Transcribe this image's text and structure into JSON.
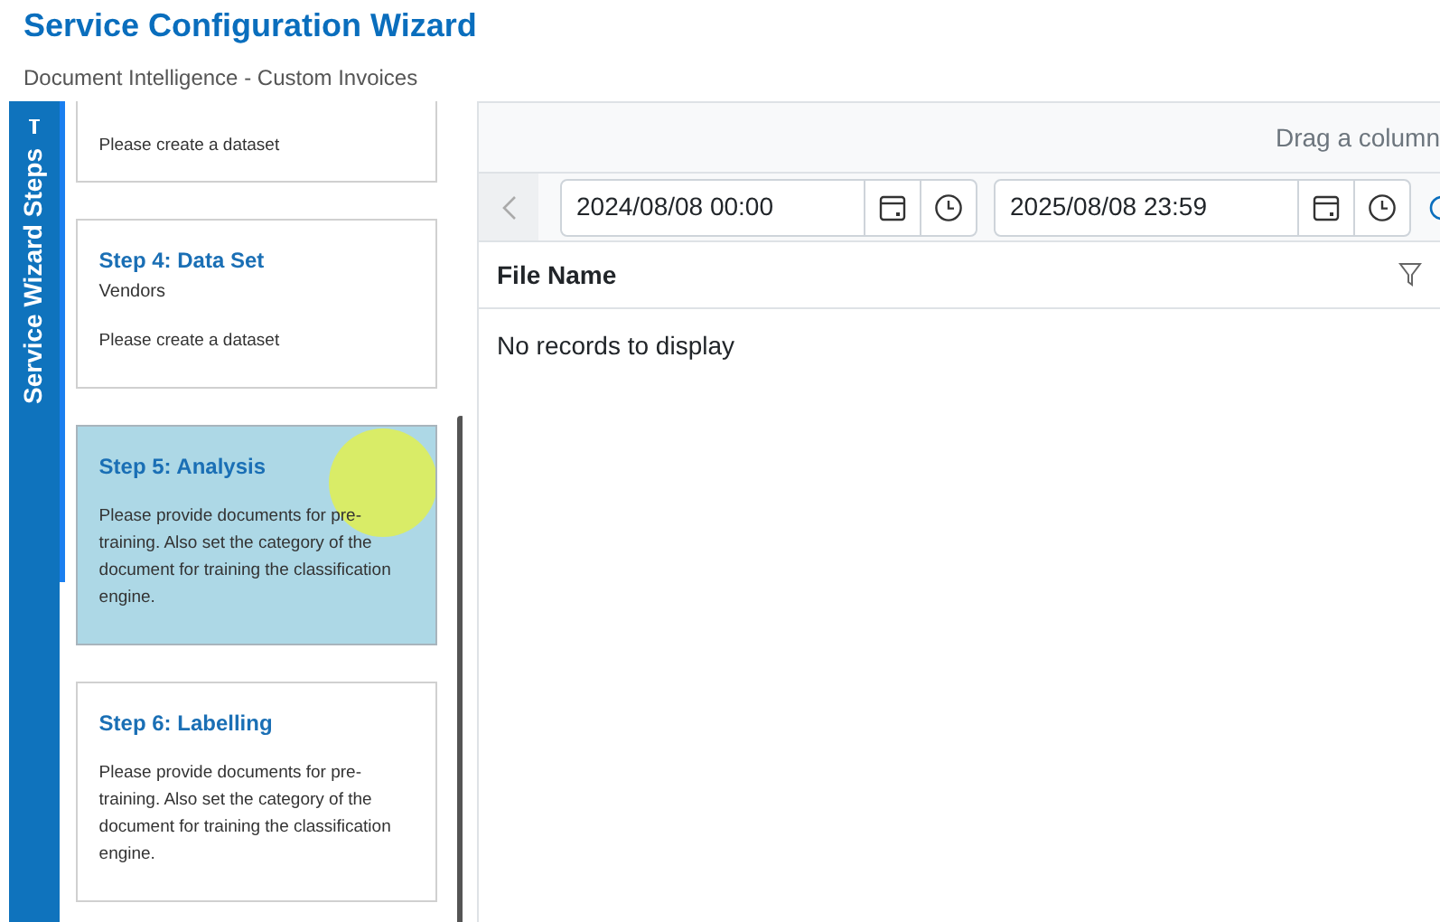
{
  "header": {
    "title": "Service Configuration Wizard",
    "subtitle": "Document Intelligence - Custom Invoices"
  },
  "sidebar": {
    "tab_label": "Service Wizard Steps",
    "expanded": true
  },
  "steps": [
    {
      "kind": "partial",
      "description": "Please create a dataset",
      "selected": false
    },
    {
      "kind": "full",
      "title": "Step 4: Data Set",
      "subtitle": "Vendors",
      "description": "Please create a dataset",
      "selected": false
    },
    {
      "kind": "full",
      "title": "Step 5: Analysis",
      "description": "Please provide documents for pre-training. Also set the category of the document for training the classification engine.",
      "selected": true
    },
    {
      "kind": "full",
      "title": "Step 6: Labelling",
      "description": "Please provide documents for pre-training. Also set the category of the document for training the classification engine.",
      "selected": false
    }
  ],
  "grid": {
    "group_hint": "Drag a column",
    "date_from": "2024/08/08 00:00",
    "date_to": "2025/08/08 23:59",
    "columns": [
      "File Name"
    ],
    "empty_message": "No records to display"
  }
}
